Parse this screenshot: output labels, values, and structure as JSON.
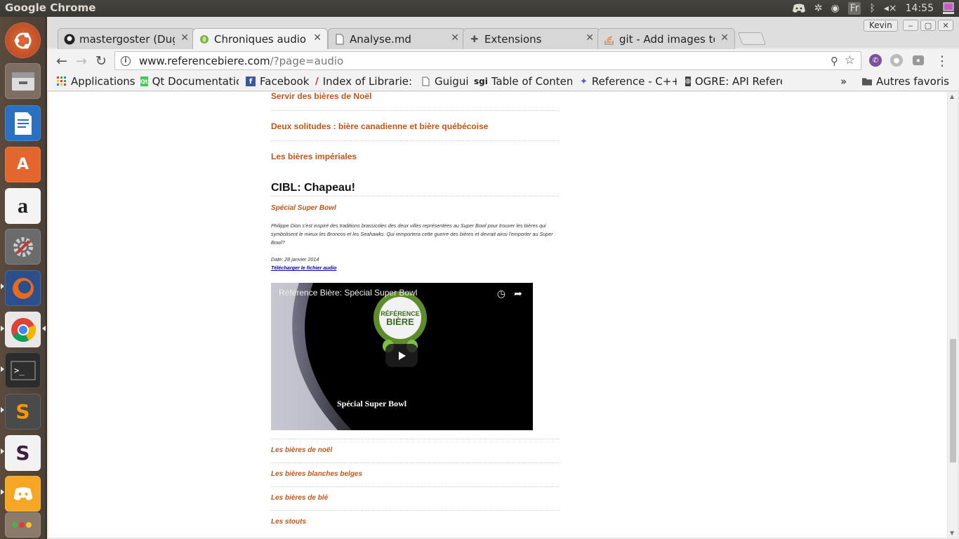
{
  "os_panel": {
    "app_title": "Google Chrome",
    "keyboard_layout": "Fr",
    "clock": "14:55"
  },
  "launcher": {
    "items": [
      "Ubuntu Dash",
      "Files",
      "LibreOffice Writer",
      "Ubuntu Software",
      "Amazon",
      "System Settings",
      "Firefox",
      "Google Chrome",
      "Terminal",
      "Sublime Text",
      "Slack",
      "Discord",
      "Workspace"
    ]
  },
  "browser": {
    "profile_name": "Kevin",
    "tabs": [
      {
        "label": "mastergoster (Dug",
        "icon": "github-icon"
      },
      {
        "label": "Chroniques audio -",
        "icon": "reference-biere-icon",
        "active": true
      },
      {
        "label": "Analyse.md",
        "icon": "document-icon"
      },
      {
        "label": "Extensions",
        "icon": "puzzle-icon"
      },
      {
        "label": "git - Add images to",
        "icon": "stackoverflow-icon"
      }
    ],
    "url_host": "www.referencebiere.com",
    "url_path": "/?page=audio",
    "bookmarks": [
      {
        "label": "Applications",
        "icon": "apps-grid-icon"
      },
      {
        "label": "Qt Documentatic",
        "icon": "qt-icon"
      },
      {
        "label": "Facebook",
        "icon": "facebook-icon"
      },
      {
        "label": "Index of Librarie:",
        "icon": "pen-icon"
      },
      {
        "label": "Guigui",
        "icon": "page-icon"
      },
      {
        "label": "Table of Content:",
        "icon": "sgi-icon",
        "prefix": "sgi"
      },
      {
        "label": "Reference - C++ R",
        "icon": "cplusplus-icon"
      },
      {
        "label": "OGRE: API Refere",
        "icon": "ogre-icon"
      }
    ],
    "other_bookmarks": "Autres favoris",
    "overflow": "»"
  },
  "page": {
    "top_links": [
      "Servir des bières de Noël",
      "Deux solitudes : bière canadienne et bière québécoise",
      "Les bières impériales"
    ],
    "section_title": "CIBL: Chapeau!",
    "episode": {
      "title": "Spécial Super Bowl",
      "description": "Philippe Dion s'est inspiré des traditions brassicoles des deux villes représentées au Super Bowl pour trouver les bières qui symbolisent le mieux les Broncos et les Seahawks. Qui remportera cette guerre des bières et devrait ainsi l'emporter au Super Bowl?",
      "date": "Date: 28 janvier 2014",
      "download": "Télécharger le fichier audio"
    },
    "video": {
      "title": "Référence Bière: Spécial Super Bowl",
      "caption": "Spécial Super Bowl",
      "logo_text": "RÉFÉRENCE BIÈRE"
    },
    "categories": [
      "Les bières de noël",
      "Les bières blanches belges",
      "Les bières de blé",
      "Les stouts"
    ]
  }
}
